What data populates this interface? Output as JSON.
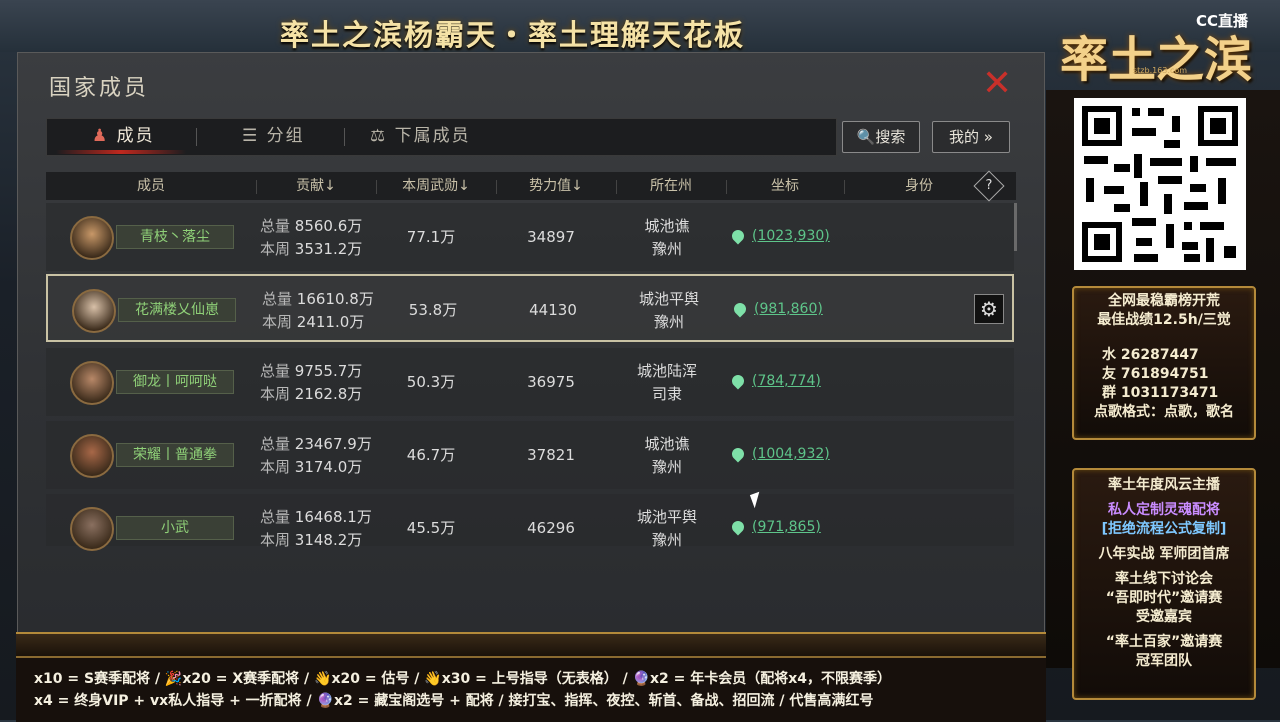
{
  "stream": {
    "title": "率土之滨杨霸天・率土理解天花板",
    "platform": "CC直播",
    "brand": "率土之滨",
    "brand_sub": "stzb.163.com"
  },
  "panel": {
    "title": "国家成员",
    "close": "✕",
    "tabs": [
      {
        "label": "成员",
        "icon": "member-icon"
      },
      {
        "label": "分组",
        "icon": "group-icon"
      },
      {
        "label": "下属成员",
        "icon": "subordinate-icon"
      }
    ],
    "search_label": "搜索",
    "mine_label": "我的 »",
    "columns": [
      "成员",
      "贡献↓",
      "本周武勋↓",
      "势力值↓",
      "所在州",
      "坐标",
      "身份"
    ],
    "help": "?",
    "total_label": "总量",
    "week_label": "本周",
    "members": [
      {
        "name": "青枝丶落尘",
        "total": "8560.6万",
        "week": "3531.2万",
        "merit": "77.1万",
        "power": "34897",
        "city": "城池谯",
        "state": "豫州",
        "coord": "(1023,930)"
      },
      {
        "name": "花满楼乂仙崽",
        "total": "16610.8万",
        "week": "2411.0万",
        "merit": "53.8万",
        "power": "44130",
        "city": "城池平舆",
        "state": "豫州",
        "coord": "(981,860)"
      },
      {
        "name": "御龙丨呵呵哒",
        "total": "9755.7万",
        "week": "2162.8万",
        "merit": "50.3万",
        "power": "36975",
        "city": "城池陆浑",
        "state": "司隶",
        "coord": "(784,774)"
      },
      {
        "name": "荣耀丨普通拳",
        "total": "23467.9万",
        "week": "3174.0万",
        "merit": "46.7万",
        "power": "37821",
        "city": "城池谯",
        "state": "豫州",
        "coord": "(1004,932)"
      },
      {
        "name": "小武",
        "total": "16468.1万",
        "week": "3148.2万",
        "merit": "45.5万",
        "power": "46296",
        "city": "城池平舆",
        "state": "豫州",
        "coord": "(971,865)"
      }
    ]
  },
  "sidebar": {
    "box1": [
      "全网最稳霸榜开荒",
      "最佳战绩12.5h/三觉",
      "水  26287447",
      "友  761894751",
      "群  1031173471",
      "点歌格式：点歌，歌名"
    ],
    "box2": [
      "率土年度风云主播",
      "私人定制灵魂配将",
      "[拒绝流程公式复制]",
      "八年实战 军师团首席",
      "率土线下讨论会",
      "“吾即时代”邀请赛",
      "受邀嘉宾",
      "“率土百家”邀请赛",
      "冠军团队"
    ]
  },
  "ticker": {
    "line1": "x10 = S赛季配将 / 🎉x20 = X赛季配将 / 👋x20 = 估号 / 👋x30 = 上号指导（无表格） / 🔮x2 = 年卡会员（配将x4，不限赛季）",
    "line2": "x4 = 终身VIP + vx私人指导 + 一折配将 / 🔮x2 = 藏宝阁选号 + 配将 / 接打宝、指挥、夜控、斩首、备战、招回流 /      代售高满红号"
  }
}
